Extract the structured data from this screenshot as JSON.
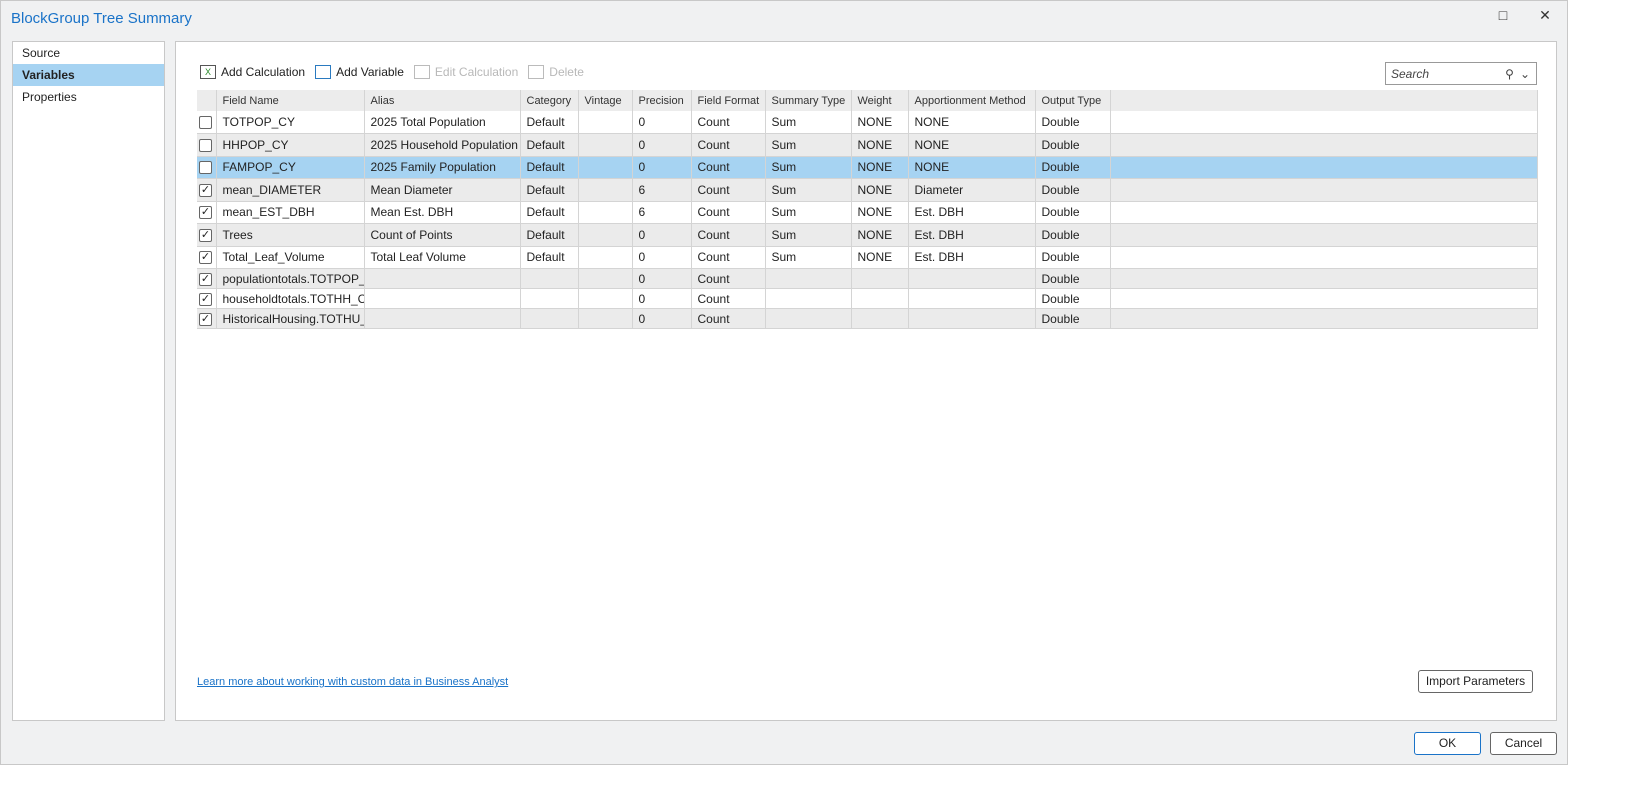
{
  "window": {
    "title": "BlockGroup Tree Summary",
    "maximize_icon": "□",
    "close_icon": "✕"
  },
  "nav": {
    "items": [
      {
        "label": "Source"
      },
      {
        "label": "Variables",
        "selected": true
      },
      {
        "label": "Properties"
      }
    ]
  },
  "toolbar": {
    "add_calculation": "Add Calculation",
    "add_variable": "Add Variable",
    "edit_calculation": "Edit Calculation",
    "delete": "Delete"
  },
  "search": {
    "placeholder": "Search",
    "icon": "⚲",
    "chevron": "⌄"
  },
  "table": {
    "columns": [
      "Field Name",
      "Alias",
      "Category",
      "Vintage",
      "Precision",
      "Field Format",
      "Summary Type",
      "Weight",
      "Apportionment Method",
      "Output Type"
    ],
    "rows": [
      {
        "checked": false,
        "cells": [
          "TOTPOP_CY",
          "2025 Total Population",
          "Default",
          "",
          "0",
          "Count",
          "Sum",
          "NONE",
          "NONE",
          "Double"
        ]
      },
      {
        "checked": false,
        "cells": [
          "HHPOP_CY",
          "2025 Household Population",
          "Default",
          "",
          "0",
          "Count",
          "Sum",
          "NONE",
          "NONE",
          "Double"
        ]
      },
      {
        "checked": false,
        "selected": true,
        "cells": [
          "FAMPOP_CY",
          "2025 Family Population",
          "Default",
          "",
          "0",
          "Count",
          "Sum",
          "NONE",
          "NONE",
          "Double"
        ]
      },
      {
        "checked": true,
        "cells": [
          "mean_DIAMETER",
          "Mean Diameter",
          "Default",
          "",
          "6",
          "Count",
          "Sum",
          "NONE",
          "Diameter",
          "Double"
        ]
      },
      {
        "checked": true,
        "cells": [
          "mean_EST_DBH",
          "Mean Est. DBH",
          "Default",
          "",
          "6",
          "Count",
          "Sum",
          "NONE",
          "Est. DBH",
          "Double"
        ]
      },
      {
        "checked": true,
        "cells": [
          "Trees",
          "Count of Points",
          "Default",
          "",
          "0",
          "Count",
          "Sum",
          "NONE",
          "Est. DBH",
          "Double"
        ]
      },
      {
        "checked": true,
        "cells": [
          "Total_Leaf_Volume",
          "Total Leaf Volume",
          "Default",
          "",
          "0",
          "Count",
          "Sum",
          "NONE",
          "Est. DBH",
          "Double"
        ]
      },
      {
        "checked": true,
        "cells": [
          "populationtotals.TOTPOP_CY",
          "",
          "",
          "",
          "0",
          "Count",
          "",
          "",
          "",
          "Double"
        ]
      },
      {
        "checked": true,
        "cells": [
          "householdtotals.TOTHH_CY",
          "",
          "",
          "",
          "0",
          "Count",
          "",
          "",
          "",
          "Double"
        ]
      },
      {
        "checked": true,
        "cells": [
          "HistoricalHousing.TOTHU_CY",
          "",
          "",
          "",
          "0",
          "Count",
          "",
          "",
          "",
          "Double"
        ]
      }
    ]
  },
  "footer": {
    "learn_more": "Learn more about working with custom data in Business Analyst",
    "import_parameters": "Import Parameters",
    "ok": "OK",
    "cancel": "Cancel"
  }
}
